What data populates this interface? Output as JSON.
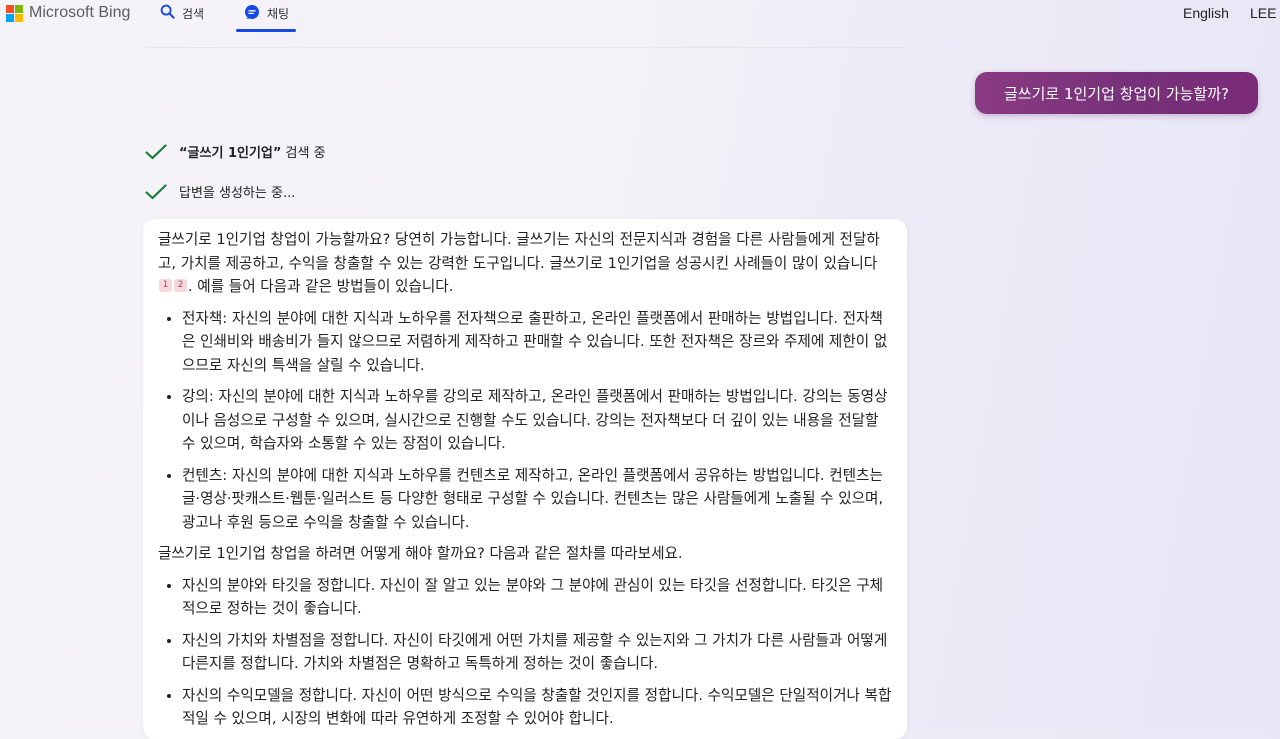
{
  "header": {
    "brand": "Microsoft Bing",
    "tabs": [
      {
        "label": "검색",
        "icon": "search-icon"
      },
      {
        "label": "채팅",
        "icon": "chat-icon",
        "active": true
      }
    ],
    "language": "English",
    "user": "LEE"
  },
  "colors": {
    "accent": "#174ae4",
    "user_bubble": "#7a3179",
    "check": "#1c7c3c"
  },
  "conversation": {
    "user_message": "글쓰기로 1인기업 창업이 가능할까?",
    "status_search": {
      "query": "“글쓰기 1인기업”",
      "suffix": " 검색 중"
    },
    "status_generating": "답변을 생성하는 중...",
    "answer": {
      "intro_before": "글쓰기로 1인기업 창업이 가능할까요? 당연히 가능합니다. 글쓰기는 자신의 전문지식과 경험을 다른 사람들에게 전달하고, 가치를 제공하고, 수익을 창출할 수 있는 강력한 도구입니다. 글쓰기로 1인기업을 성공시킨 사례들이 많이 있습니다",
      "citations": [
        "1",
        "2"
      ],
      "intro_after": ". 예를 들어 다음과 같은 방법들이 있습니다.",
      "methods": [
        "전자책: 자신의 분야에 대한 지식과 노하우를 전자책으로 출판하고, 온라인 플랫폼에서 판매하는 방법입니다. 전자책은 인쇄비와 배송비가 들지 않으므로 저렴하게 제작하고 판매할 수 있습니다. 또한 전자책은 장르와 주제에 제한이 없으므로 자신의 특색을 살릴 수 있습니다.",
        "강의: 자신의 분야에 대한 지식과 노하우를 강의로 제작하고, 온라인 플랫폼에서 판매하는 방법입니다. 강의는 동영상이나 음성으로 구성할 수 있으며, 실시간으로 진행할 수도 있습니다. 강의는 전자책보다 더 깊이 있는 내용을 전달할 수 있으며, 학습자와 소통할 수 있는 장점이 있습니다.",
        "컨텐츠: 자신의 분야에 대한 지식과 노하우를 컨텐츠로 제작하고, 온라인 플랫폼에서 공유하는 방법입니다. 컨텐츠는 글·영상·팟캐스트·웹툰·일러스트 등 다양한 형태로 구성할 수 있습니다. 컨텐츠는 많은 사람들에게 노출될 수 있으며, 광고나 후원 등으로 수익을 창출할 수 있습니다."
      ],
      "procedure_intro": "글쓰기로 1인기업 창업을 하려면 어떻게 해야 할까요? 다음과 같은 절차를 따라보세요.",
      "steps": [
        "자신의 분야와 타깃을 정합니다. 자신이 잘 알고 있는 분야와 그 분야에 관심이 있는 타깃을 선정합니다. 타깃은 구체적으로 정하는 것이 좋습니다.",
        "자신의 가치와 차별점을 정합니다. 자신이 타깃에게 어떤 가치를 제공할 수 있는지와 그 가치가 다른 사람들과 어떻게 다른지를 정합니다. 가치와 차별점은 명확하고 독특하게 정하는 것이 좋습니다.",
        "자신의 수익모델을 정합니다. 자신이 어떤 방식으로 수익을 창출할 것인지를 정합니다. 수익모델은 단일적이거나 복합적일 수 있으며, 시장의 변화에 따라 유연하게 조정할 수 있어야 합니다."
      ]
    }
  }
}
